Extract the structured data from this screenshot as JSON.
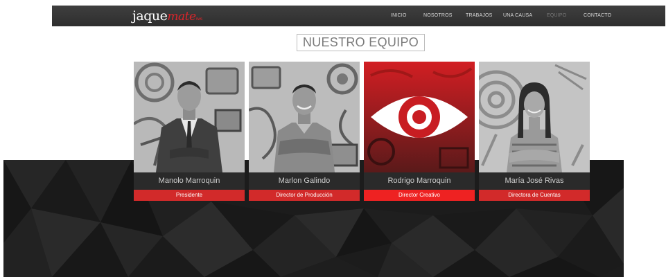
{
  "header": {
    "logo": {
      "main": "jaque",
      "accent": "mate",
      "suffix": "nws"
    },
    "nav": [
      {
        "label": "INICIO",
        "active": false
      },
      {
        "label": "NOSOTROS",
        "active": false
      },
      {
        "label": "TRABAJOS",
        "active": false
      },
      {
        "label": "UNA CAUSA",
        "active": false
      },
      {
        "label": "EQUIPO",
        "active": true
      },
      {
        "label": "CONTACTO",
        "active": false
      }
    ]
  },
  "team": {
    "title": "NUESTRO EQUIPO",
    "members": [
      {
        "name": "Manolo Marroquin",
        "role": "Presidente",
        "photo": "photo-person-icon"
      },
      {
        "name": "Marlon Galindo",
        "role": "Director de Producción",
        "photo": "photo-person-icon"
      },
      {
        "name": "Rodrigo Marroquin",
        "role": "Director Creativo",
        "photo": "eye-icon"
      },
      {
        "name": "María José Rivas",
        "role": "Directora de Cuentas",
        "photo": "photo-person-icon"
      }
    ]
  },
  "colors": {
    "navbar": "#333333",
    "accent_red": "#d22a2a",
    "name_bar": "#2a2a2a",
    "dark_background": "#1c1c1c"
  }
}
